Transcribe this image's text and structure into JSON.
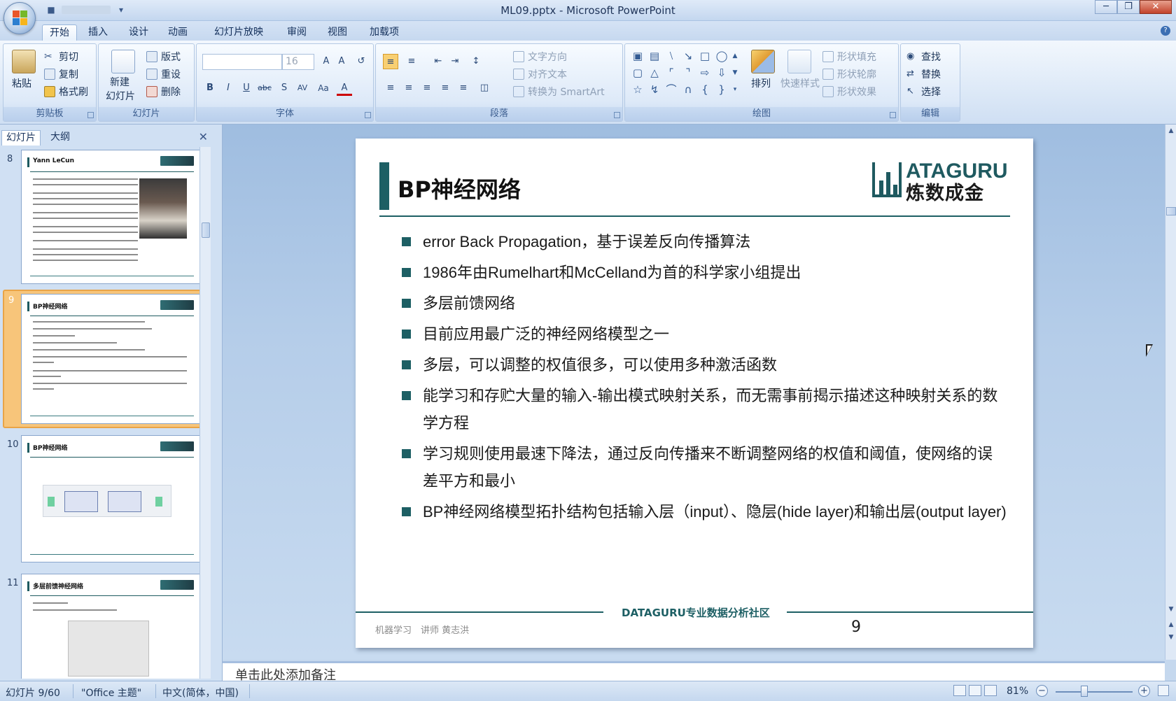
{
  "window": {
    "title": "ML09.pptx - Microsoft PowerPoint",
    "minimize": "─",
    "maximize": "❐",
    "close": "✕"
  },
  "ribbon_tabs": [
    "开始",
    "插入",
    "设计",
    "动画",
    "幻灯片放映",
    "审阅",
    "视图",
    "加载项"
  ],
  "ribbon": {
    "clipboard": {
      "label": "剪贴板",
      "paste": "粘贴",
      "cut": "剪切",
      "copy": "复制",
      "format_painter": "格式刷"
    },
    "slides": {
      "label": "幻灯片",
      "new_slide_1": "新建",
      "new_slide_2": "幻灯片",
      "layout": "版式",
      "reset": "重设",
      "delete": "删除"
    },
    "font": {
      "label": "字体",
      "font_size": "16"
    },
    "paragraph": {
      "label": "段落",
      "text_direction": "文字方向",
      "align_text": "对齐文本",
      "convert_smartart": "转换为 SmartArt"
    },
    "drawing": {
      "label": "绘图",
      "arrange": "排列",
      "quick_styles": "快速样式",
      "shape_fill": "形状填充",
      "shape_outline": "形状轮廓",
      "shape_effects": "形状效果"
    },
    "editing": {
      "label": "编辑",
      "find": "查找",
      "replace": "替换",
      "select": "选择"
    }
  },
  "pane": {
    "tab_slides": "幻灯片",
    "tab_outline": "大纲",
    "close": "✕",
    "thumbnails": [
      {
        "num": "8",
        "title": "Yann LeCun"
      },
      {
        "num": "9",
        "title": "BP神经网络"
      },
      {
        "num": "10",
        "title": "BP神经网络"
      },
      {
        "num": "11",
        "title": "多层前馈神经网络"
      }
    ]
  },
  "slide": {
    "title": "BP神经网络",
    "logo_en": "ATAGURU",
    "logo_zh": "炼数成金",
    "bullets": [
      "error Back Propagation，基于误差反向传播算法",
      "1986年由Rumelhart和McCelland为首的科学家小组提出",
      "多层前馈网络",
      "目前应用最广泛的神经网络模型之一",
      "多层，可以调整的权值很多，可以使用多种激活函数",
      "能学习和存贮大量的输入-输出模式映射关系，而无需事前揭示描述这种映射关系的数学方程",
      "学习规则使用最速下降法，通过反向传播来不断调整网络的权值和阈值，使网络的误差平方和最小",
      "BP神经网络模型拓扑结构包括输入层（input）、隐层(hide layer)和输出层(output layer)"
    ],
    "footer_center": "DATAGURU专业数据分析社区",
    "footer_left": "机器学习　讲师 黄志洪",
    "page_number": "9"
  },
  "notes_placeholder": "单击此处添加备注",
  "status": {
    "slide_counter": "幻灯片 9/60",
    "theme": "\"Office 主题\"",
    "language": "中文(简体，中国)",
    "zoom": "81%"
  },
  "colors": {
    "accent": "#1d5f64",
    "ribbon_bg": "#dde9f7",
    "selected_thumb": "#f7c57a"
  }
}
